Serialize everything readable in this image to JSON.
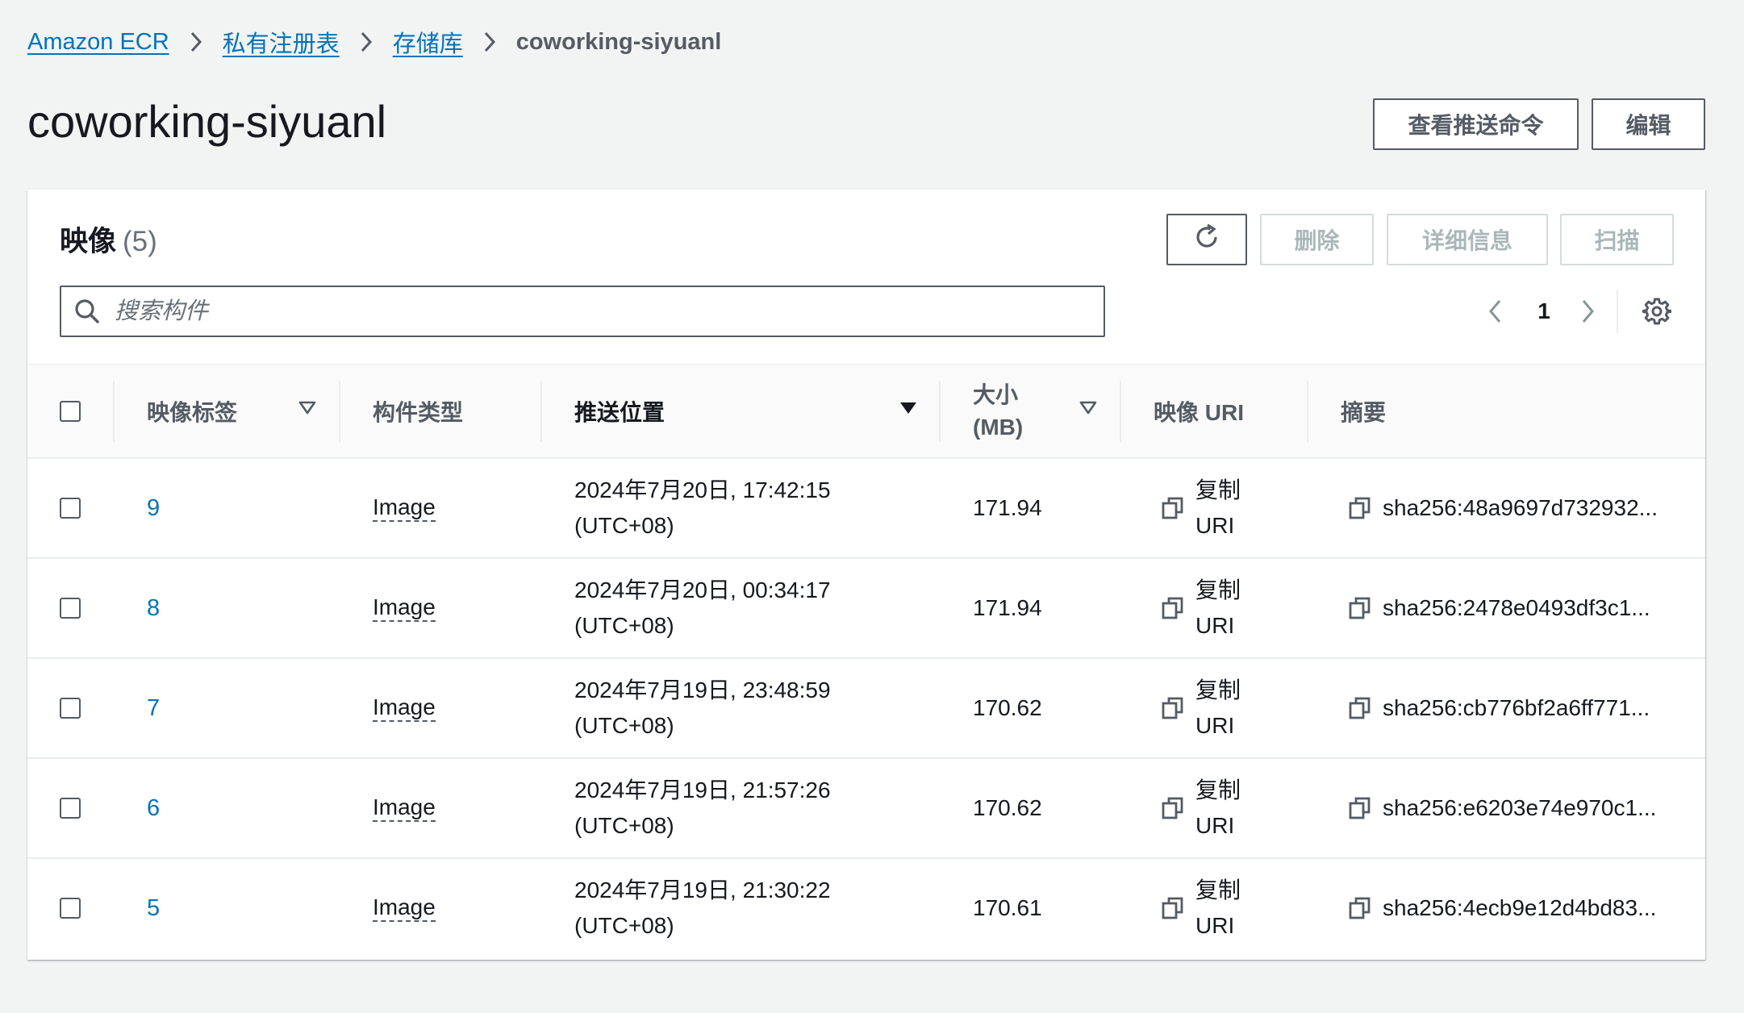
{
  "breadcrumb": {
    "items": [
      "Amazon ECR",
      "私有注册表",
      "存储库"
    ],
    "current": "coworking-siyuanl"
  },
  "page": {
    "title": "coworking-siyuanl",
    "push_button": "查看推送命令",
    "edit_button": "编辑"
  },
  "images_panel": {
    "title": "映像",
    "count": "(5)",
    "delete_button": "删除",
    "details_button": "详细信息",
    "scan_button": "扫描",
    "search_placeholder": "搜索构件",
    "page_number": "1"
  },
  "table": {
    "columns": {
      "tag": "映像标签",
      "type": "构件类型",
      "pushed": "推送位置",
      "size_line1": "大小",
      "size_line2": "(MB)",
      "uri": "映像 URI",
      "digest": "摘要"
    },
    "rows": [
      {
        "tag": "9",
        "type": "Image",
        "date": "2024年7月20日, 17:42:15",
        "tz": "(UTC+08)",
        "size": "171.94",
        "copy_line1": "复制",
        "copy_line2": "URI",
        "digest": "sha256:48a9697d732932..."
      },
      {
        "tag": "8",
        "type": "Image",
        "date": "2024年7月20日, 00:34:17",
        "tz": "(UTC+08)",
        "size": "171.94",
        "copy_line1": "复制",
        "copy_line2": "URI",
        "digest": "sha256:2478e0493df3c1..."
      },
      {
        "tag": "7",
        "type": "Image",
        "date": "2024年7月19日, 23:48:59",
        "tz": "(UTC+08)",
        "size": "170.62",
        "copy_line1": "复制",
        "copy_line2": "URI",
        "digest": "sha256:cb776bf2a6ff771..."
      },
      {
        "tag": "6",
        "type": "Image",
        "date": "2024年7月19日, 21:57:26",
        "tz": "(UTC+08)",
        "size": "170.62",
        "copy_line1": "复制",
        "copy_line2": "URI",
        "digest": "sha256:e6203e74e970c1..."
      },
      {
        "tag": "5",
        "type": "Image",
        "date": "2024年7月19日, 21:30:22",
        "tz": "(UTC+08)",
        "size": "170.61",
        "copy_line1": "复制",
        "copy_line2": "URI",
        "digest": "sha256:4ecb9e12d4bd83..."
      }
    ]
  },
  "colors": {
    "link": "#0073bb",
    "background": "#f2f3f3",
    "text": "#16191f",
    "secondary_text": "#545b64",
    "disabled": "#aab7b8"
  }
}
